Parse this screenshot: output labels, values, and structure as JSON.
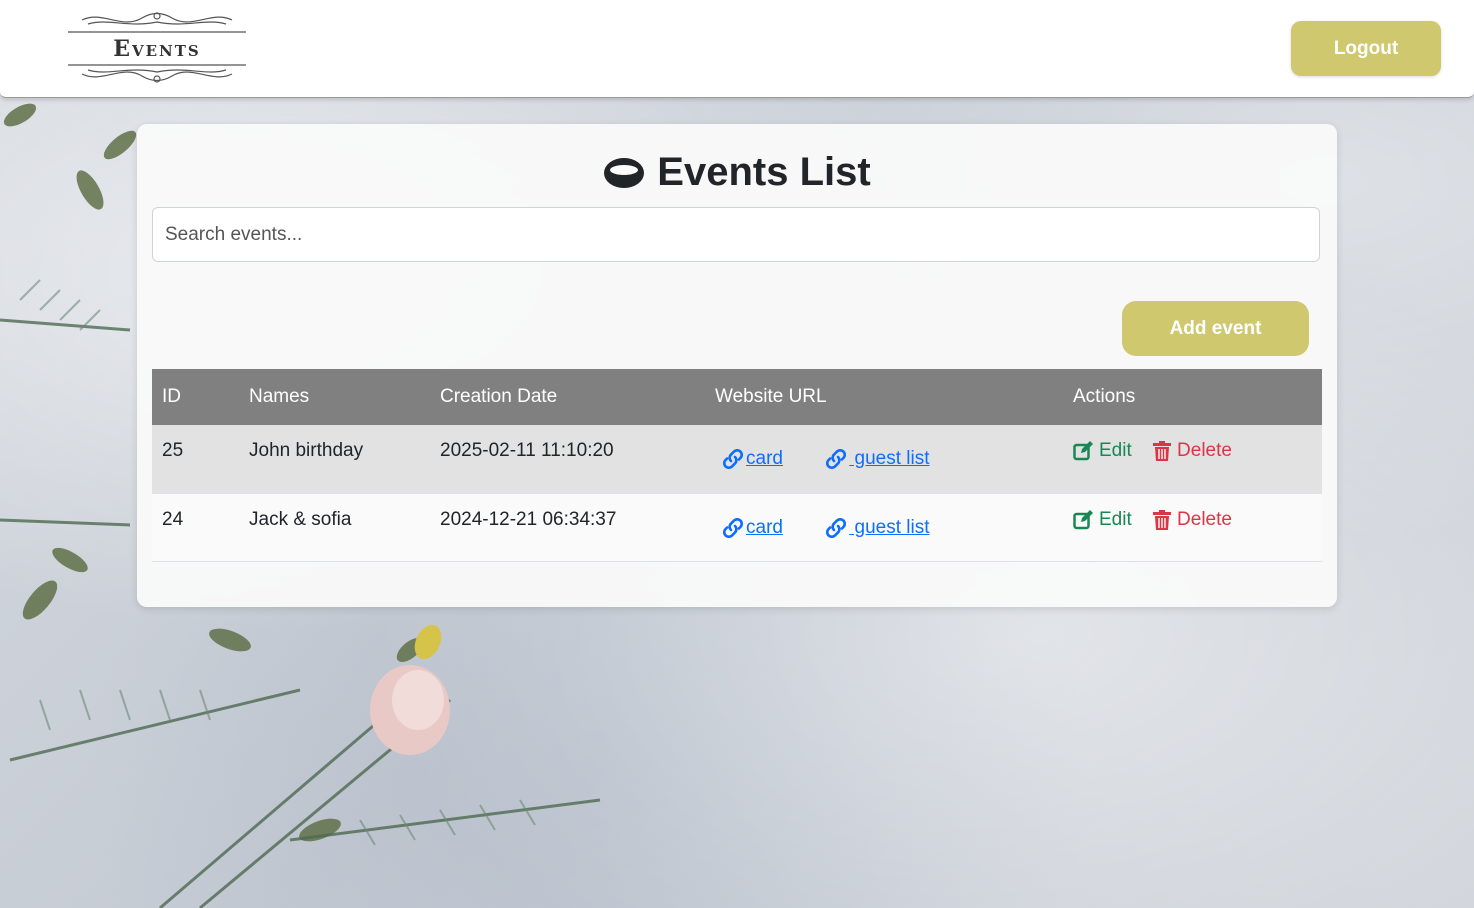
{
  "header": {
    "logo_text": "Events",
    "logout_label": "Logout"
  },
  "main": {
    "title": "Events List",
    "search_placeholder": "Search events...",
    "add_label": "Add event"
  },
  "table": {
    "columns": [
      "ID",
      "Names",
      "Creation Date",
      "Website URL",
      "Actions"
    ],
    "rows": [
      {
        "id": "25",
        "name": "John birthday",
        "date": "2025-02-11 11:10:20",
        "link1": "card",
        "link2": " guest list",
        "edit": "Edit",
        "delete": "Delete"
      },
      {
        "id": "24",
        "name": "Jack & sofia",
        "date": "2024-12-21 06:34:37",
        "link1": "card",
        "link2": " guest list",
        "edit": "Edit",
        "delete": "Delete"
      }
    ]
  },
  "colors": {
    "accent": "#cfc86f",
    "header_row": "#808080",
    "link": "#0d6efd",
    "edit": "#198754",
    "delete": "#dc3545"
  },
  "icons": [
    "ring-icon",
    "link-icon",
    "edit-icon",
    "trash-icon",
    "ornament-icon"
  ]
}
